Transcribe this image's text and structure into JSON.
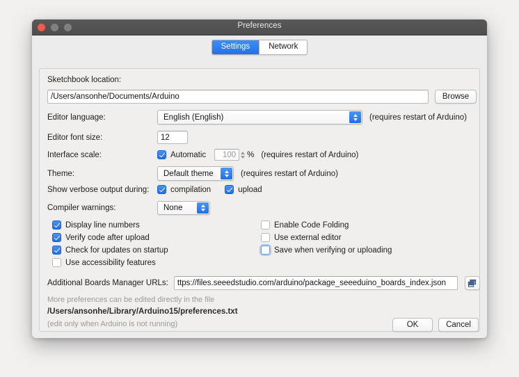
{
  "window": {
    "title": "Preferences",
    "traffic_lights": [
      "close-light",
      "minimize-light",
      "zoom-light"
    ]
  },
  "tabs": [
    {
      "label": "Settings",
      "active": true
    },
    {
      "label": "Network",
      "active": false
    }
  ],
  "settings": {
    "sketchbook": {
      "label": "Sketchbook location:",
      "value": "/Users/ansonhe/Documents/Arduino",
      "browse_label": "Browse"
    },
    "editor_language": {
      "label": "Editor language:",
      "value": "English (English)",
      "note": "(requires restart of Arduino)"
    },
    "editor_font_size": {
      "label": "Editor font size:",
      "value": "12"
    },
    "interface_scale": {
      "label": "Interface scale:",
      "automatic_label": "Automatic",
      "automatic_checked": true,
      "scale_value": "100",
      "percent_label": "%",
      "note": "(requires restart of Arduino)"
    },
    "theme": {
      "label": "Theme:",
      "value": "Default theme",
      "note": "(requires restart of Arduino)"
    },
    "verbose": {
      "label": "Show verbose output during:",
      "compilation_label": "compilation",
      "compilation_checked": true,
      "upload_label": "upload",
      "upload_checked": true
    },
    "compiler_warnings": {
      "label": "Compiler warnings:",
      "value": "None"
    },
    "checkboxes_left": [
      {
        "label": "Display line numbers",
        "checked": true
      },
      {
        "label": "Verify code after upload",
        "checked": true
      },
      {
        "label": "Check for updates on startup",
        "checked": true
      },
      {
        "label": "Use accessibility features",
        "checked": false
      }
    ],
    "checkboxes_right": [
      {
        "label": "Enable Code Folding",
        "checked": false,
        "focused": false
      },
      {
        "label": "Use external editor",
        "checked": false,
        "focused": false
      },
      {
        "label": "Save when verifying or uploading",
        "checked": false,
        "focused": true
      }
    ],
    "boards_urls": {
      "label": "Additional Boards Manager URLs:",
      "value": "ttps://files.seeedstudio.com/arduino/package_seeeduino_boards_index.json",
      "button_icon": "open-windows-icon"
    },
    "footer": {
      "line1": "More preferences can be edited directly in the file",
      "line2": "/Users/ansonhe/Library/Arduino15/preferences.txt",
      "line3": "(edit only when Arduino is not running)"
    }
  },
  "buttons": {
    "ok": "OK",
    "cancel": "Cancel"
  },
  "colors": {
    "accent": "#1f73ea",
    "tab_active_text": "#ffffff",
    "titlebar": "#4e4e4e"
  }
}
